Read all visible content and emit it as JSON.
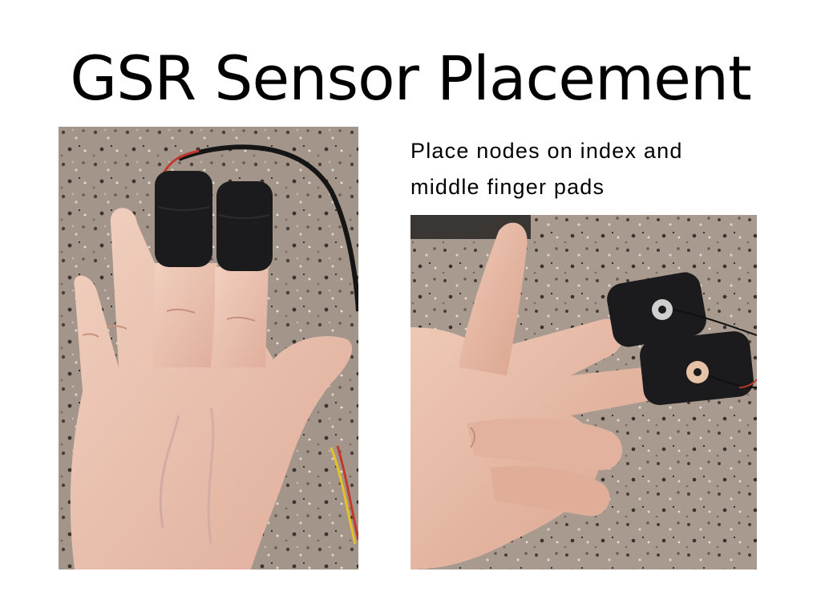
{
  "slide": {
    "title": "GSR Sensor Placement",
    "caption_line1": "Place nodes on index and",
    "caption_line2": "middle finger pads"
  },
  "photos": {
    "left": {
      "subject": "back of hand with two black finger sleeves on index and middle fingers, wired sensor cable"
    },
    "right": {
      "subject": "palm side of fingers showing metal electrode snaps inside black finger sleeves"
    }
  },
  "colors": {
    "background": "#ffffff",
    "text": "#000000",
    "granite": "#9c8f86",
    "skin": "#e9c2b0",
    "sleeve": "#1b1b1d"
  }
}
